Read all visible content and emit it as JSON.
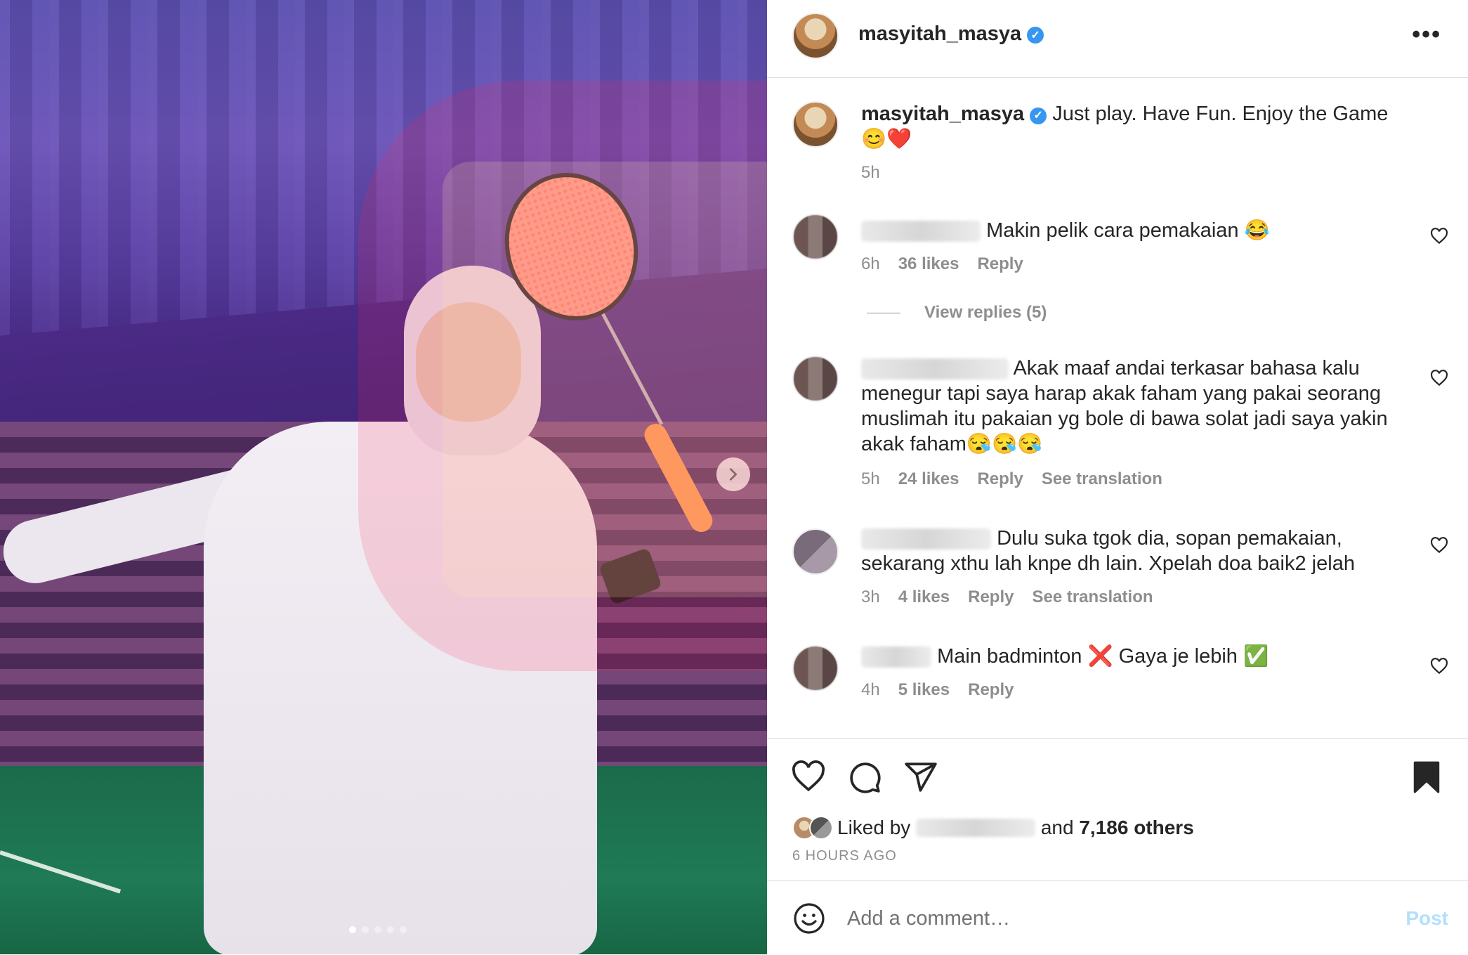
{
  "post": {
    "username": "masyitah_masya",
    "caption": "Just play. Have Fun. Enjoy the Game 😊❤️",
    "caption_time": "5h"
  },
  "comments": [
    {
      "name_suffix": "",
      "text": "Makin pelik cara pemakaian 😂",
      "time": "6h",
      "likes": "36 likes",
      "reply": "Reply",
      "translation": ""
    },
    {
      "name_suffix": "",
      "text": "Akak maaf andai terkasar bahasa kalu menegur tapi saya harap akak faham yang pakai seorang muslimah itu pakaian yg bole di bawa solat jadi saya yakin akak faham😪😪😪",
      "time": "5h",
      "likes": "24 likes",
      "reply": "Reply",
      "translation": "See translation"
    },
    {
      "name_suffix": "",
      "text": "Dulu suka tgok dia, sopan pemakaian, sekarang xthu lah knpe dh lain. Xpelah doa baik2 jelah",
      "time": "3h",
      "likes": "4 likes",
      "reply": "Reply",
      "translation": "See translation"
    },
    {
      "name_suffix": "",
      "text": "Main badminton ❌ Gaya je lebih ✅",
      "time": "4h",
      "likes": "5 likes",
      "reply": "Reply",
      "translation": ""
    }
  ],
  "view_replies": "View replies (5)",
  "likes": {
    "prefix": "Liked by",
    "middle": "and",
    "others": "7,186 others"
  },
  "time_ago": "6 HOURS AGO",
  "comment_box": {
    "placeholder": "Add a comment…",
    "post_label": "Post"
  },
  "carousel": {
    "slides": 5,
    "active": 1
  },
  "colors": {
    "verified": "#3797f0",
    "post_disabled": "#b2dffc",
    "secondary_text": "#8e8e8e"
  },
  "icons": [
    "heart-icon",
    "comment-icon",
    "share-icon",
    "bookmark-icon",
    "emoji-icon",
    "more-icon",
    "chevron-right-icon"
  ]
}
